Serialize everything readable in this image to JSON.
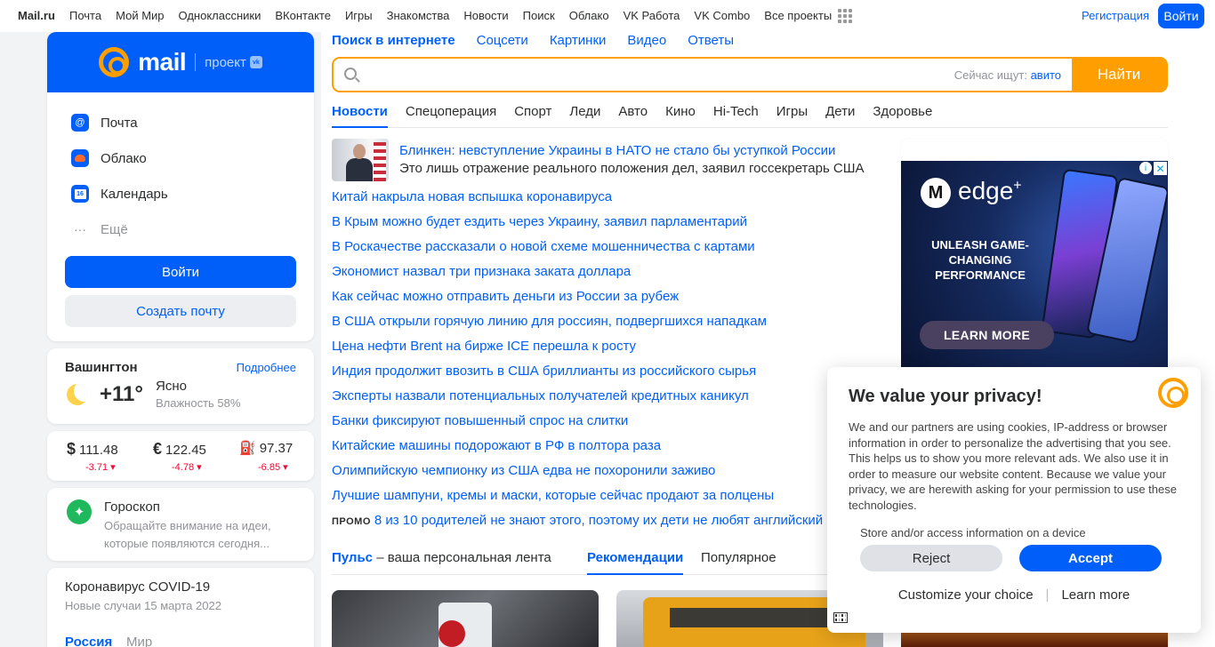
{
  "topbar": {
    "brand": "Mail.ru",
    "links": [
      "Почта",
      "Мой Мир",
      "Одноклассники",
      "ВКонтакте",
      "Игры",
      "Знакомства",
      "Новости",
      "Поиск",
      "Облако",
      "VK Работа",
      "VK Combo",
      "Все проекты"
    ],
    "register": "Регистрация",
    "login": "Войти"
  },
  "mail_card": {
    "logo_text": "mail",
    "project_text": "проект",
    "vk_badge": "vk",
    "services": [
      "Почта",
      "Облако",
      "Календарь"
    ],
    "calendar_day": "16",
    "more": "Ещё",
    "more_dots": "···",
    "login_button": "Войти",
    "create_button": "Создать почту"
  },
  "weather": {
    "city": "Вашингтон",
    "more": "Подробнее",
    "temp": "+11°",
    "condition": "Ясно",
    "humidity": "Влажность 58%"
  },
  "rates": [
    {
      "symbol": "$",
      "value": "111.48",
      "change": "-3.71 ▾"
    },
    {
      "symbol": "€",
      "value": "122.45",
      "change": "-4.78 ▾"
    },
    {
      "symbol": "⛽",
      "value": "97.37",
      "change": "-6.85 ▾"
    }
  ],
  "horoscope": {
    "icon": "✦",
    "title": "Гороскоп",
    "text": "Обращайте внимание на идеи, которые появляются сегодня..."
  },
  "covid": {
    "title": "Коронавирус COVID-19",
    "subtitle": "Новые случаи 15 марта 2022",
    "tab_russia": "Россия",
    "tab_world": "Мир"
  },
  "search": {
    "tabs": [
      "Поиск в интернете",
      "Соцсети",
      "Картинки",
      "Видео",
      "Ответы"
    ],
    "hint_label": "Сейчас ищут:",
    "hint_value": "авито",
    "button": "Найти"
  },
  "news_tabs": [
    "Новости",
    "Спецоперация",
    "Спорт",
    "Леди",
    "Авто",
    "Кино",
    "Hi-Tech",
    "Игры",
    "Дети",
    "Здоровье"
  ],
  "news": {
    "lead_title": "Блинкен: невступление Украины в НАТО не стало бы уступкой России",
    "lead_subtitle": "Это лишь отражение реального положения дел, заявил госсекретарь США",
    "items": [
      "Китай накрыла новая вспышка коронавируса",
      "В Крым можно будет ездить через Украину, заявил парламентарий",
      "В Роскачестве рассказали о новой схеме мошенничества с картами",
      "Экономист назвал три признака заката доллара",
      "Как сейчас можно отправить деньги из России за рубеж",
      "В США открыли горячую линию для россиян, подвергшихся нападкам",
      "Цена нефти Brent на бирже ICE перешла к росту",
      "Индия продолжит ввозить в США бриллианты из российского сырья",
      "Эксперты назвали потенциальных получателей кредитных каникул",
      "Банки фиксируют повышенный спрос на слитки",
      "Китайские машины подорожают в РФ в полтора раза",
      "Олимпийскую чемпионку из США едва не похоронили заживо",
      "Лучшие шампуни, кремы и маски, которые сейчас продают за полцены"
    ],
    "promo_tag": "ПРОМО",
    "promo_text": "8 из 10 родителей не знают этого, поэтому их дети не любят английский"
  },
  "pulse": {
    "title": "Пульс",
    "title_rest": " – ваша персональная лента",
    "tab_recommend": "Рекомендации",
    "tab_popular": "Популярное"
  },
  "ad": {
    "logo": "M",
    "brand": "edge",
    "brand_sup": "+",
    "headline": "UNLEASH GAME-CHANGING PERFORMANCE",
    "cta": "LEARN MORE",
    "info": "i",
    "close": "✕"
  },
  "privacy": {
    "title": "We value your privacy!",
    "text": "We and our partners are using cookies, IP-address or browser information in order to personalize the advertising that you see. This helps us to show you more relevant ads. We also use it in order to measure our website content. Because we value your privacy, we are herewith asking for your permission to use these technologies.",
    "scroll_text": "Store and/or access information on a device",
    "reject": "Reject",
    "accept": "Accept",
    "customize": "Customize your choice",
    "separator": "|",
    "learn_more": "Learn more"
  },
  "colors": {
    "brand_blue": "#005ff9",
    "accent_orange": "#ff9e00",
    "negative_red": "#ed0a34"
  }
}
